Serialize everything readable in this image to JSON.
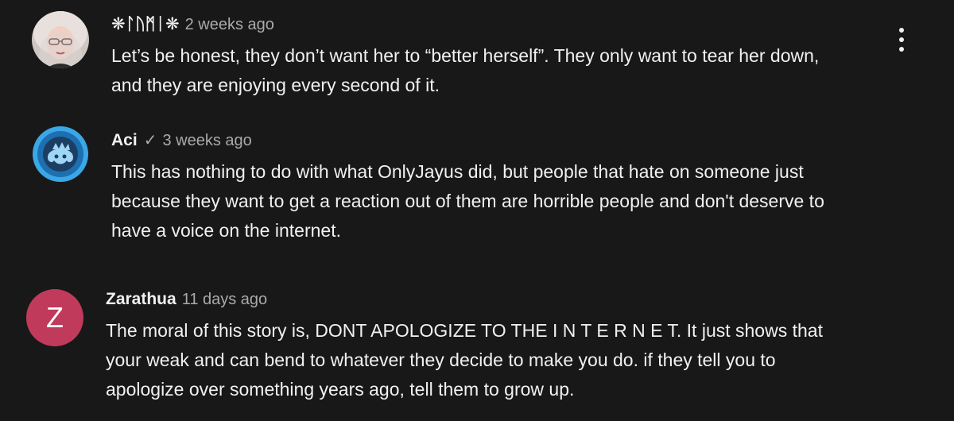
{
  "comments": [
    {
      "author": "❋ᛚᚢᛗᛁ❋",
      "verified": "",
      "time": "2 weeks ago",
      "text": "Let’s be honest, they don’t want her to “better herself”. They only want to tear her down,\nand they are enjoying every second of it.",
      "avatar": "profile-photo"
    },
    {
      "author": "Aci",
      "verified": "✓",
      "time": "3 weeks ago",
      "text": "This has nothing to do with what OnlyJayus did, but people that hate on someone just\nbecause they want to get a reaction out of them are horrible people and don't deserve to\nhave a voice on the internet.",
      "avatar": "blue-logo"
    },
    {
      "author": "Zarathua",
      "verified": "",
      "time": "11 days ago",
      "text": "The moral of this story is, DONT APOLOGIZE TO THE I N T E R N E T. It just shows that\nyour weak and can bend to whatever they decide to make you do. if they tell you to\napologize over something years ago, tell them to grow up.",
      "avatar_letter": "Z",
      "avatar_color": "#c03a5b"
    }
  ],
  "menu": {
    "icon": "more-vert-icon"
  },
  "colors": {
    "background": "#181818",
    "text": "#f1f1f1",
    "secondary_text": "#aaaaaa"
  }
}
